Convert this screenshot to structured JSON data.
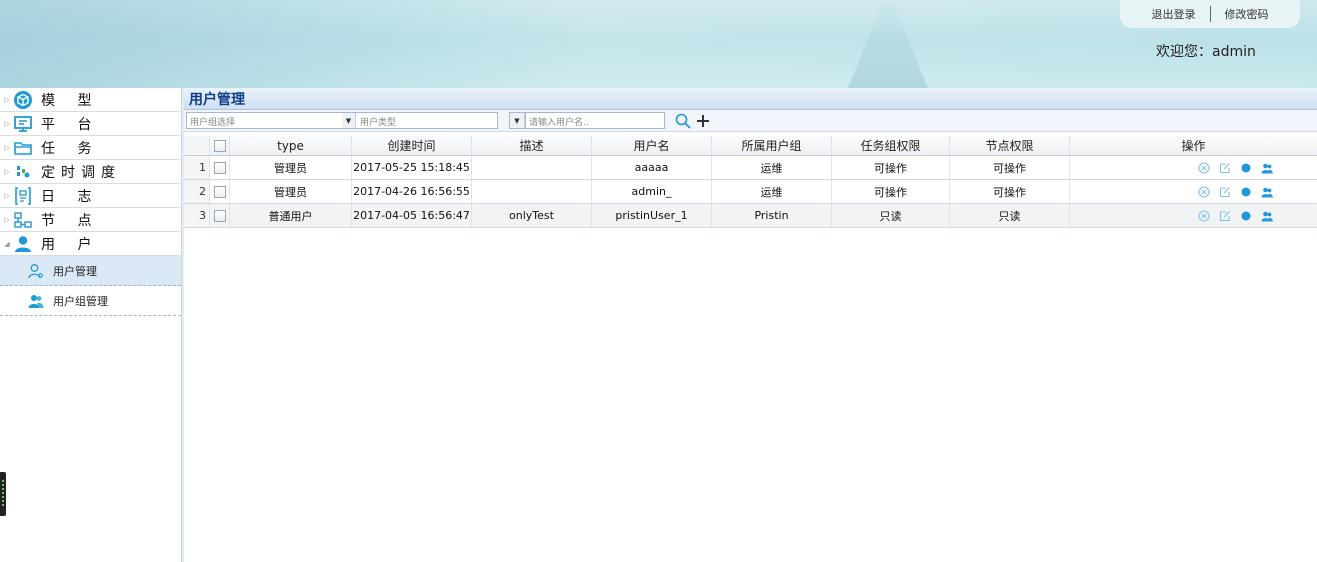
{
  "header": {
    "logout": "退出登录",
    "change_password": "修改密码",
    "welcome": "欢迎您：admin"
  },
  "sidebar": {
    "items": [
      {
        "label": "模 型",
        "icon": "cube-icon"
      },
      {
        "label": "平 台",
        "icon": "monitor-icon"
      },
      {
        "label": "任 务",
        "icon": "folder-icon"
      },
      {
        "label": "定时调度",
        "icon": "schedule-icon"
      },
      {
        "label": "日 志",
        "icon": "log-icon"
      },
      {
        "label": "节 点",
        "icon": "node-tree-icon"
      },
      {
        "label": "用 户",
        "icon": "user-icon"
      }
    ],
    "subitems": [
      {
        "label": "用户管理",
        "icon": "user-gear-icon",
        "active": true
      },
      {
        "label": "用户组管理",
        "icon": "user-group-icon",
        "active": false
      }
    ]
  },
  "panel": {
    "title": "用户管理"
  },
  "toolbar": {
    "group_placeholder": "用户组选择",
    "type_placeholder": "用户类型",
    "search_placeholder": "请输入用户名..",
    "search_icon": "search-icon",
    "add_icon": "plus-icon"
  },
  "table": {
    "columns": [
      "type",
      "创建时间",
      "描述",
      "用户名",
      "所属用户组",
      "任务组权限",
      "节点权限",
      "操作"
    ],
    "rows": [
      {
        "num": "1",
        "type": "管理员",
        "created": "2017-05-25 15:18:45",
        "desc": "",
        "username": "aaaaa",
        "group": "运维",
        "task_perm": "可操作",
        "node_perm": "可操作"
      },
      {
        "num": "2",
        "type": "管理员",
        "created": "2017-04-26 16:56:55",
        "desc": "",
        "username": "admin_",
        "group": "运维",
        "task_perm": "可操作",
        "node_perm": "可操作"
      },
      {
        "num": "3",
        "type": "普通用户",
        "created": "2017-04-05 16:56:47",
        "desc": "onlyTest",
        "username": "pristinUser_1",
        "group": "Pristin",
        "task_perm": "只读",
        "node_perm": "只读"
      }
    ]
  },
  "colors": {
    "accent": "#2196d9",
    "title_blue": "#0e3d8a"
  }
}
